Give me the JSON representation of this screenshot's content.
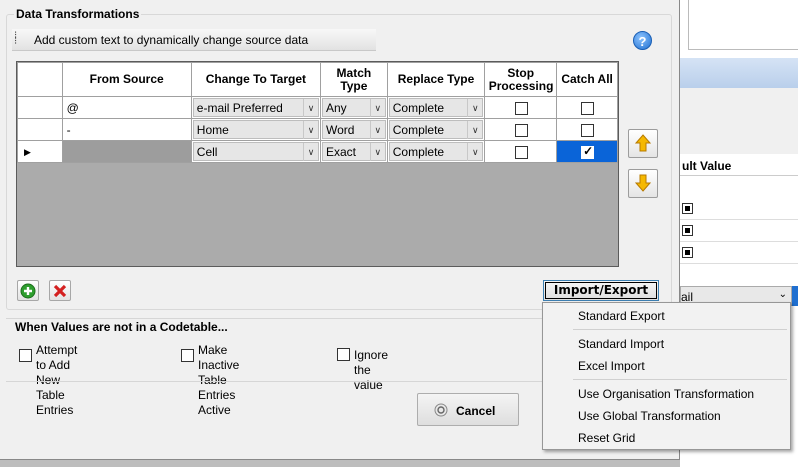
{
  "group_title": "Data Transformations",
  "info_bar_text": "Add custom text to dynamically change source data",
  "help_icon": "?",
  "grid": {
    "headers": [
      "",
      "From Source",
      "Change To Target",
      "Match Type",
      "Replace Type",
      "Stop Processing",
      "Catch All"
    ],
    "rows": [
      {
        "from": "@",
        "to": "e-mail Preferred",
        "match": "Any",
        "replace": "Complete",
        "stop": false,
        "catch_all": false
      },
      {
        "from": "-",
        "to": "Home",
        "match": "Word",
        "replace": "Complete",
        "stop": false,
        "catch_all": false
      },
      {
        "from": "",
        "to": "Cell",
        "match": "Exact",
        "replace": "Complete",
        "stop": false,
        "catch_all": true
      }
    ]
  },
  "import_export_label": "Import/Export",
  "codetable": {
    "title": "When Values are not in a Codetable...",
    "options": [
      {
        "line1": "Attempt to Add New",
        "line2": "Table Entries"
      },
      {
        "line1": "Make Inactive Table",
        "line2": "Entries Active"
      },
      {
        "line1": "Ignore the value",
        "line2": ""
      }
    ]
  },
  "cancel_label": "Cancel",
  "menu": {
    "items": [
      "Standard Export",
      "Standard Import",
      "Excel Import",
      "Use Organisation Transformation",
      "Use Global Transformation",
      "Reset Grid"
    ]
  },
  "background": {
    "column_header": "ult Value",
    "select_value": "ail"
  },
  "colors": {
    "selection_blue": "#0a64d8",
    "add_green": "#2e9e2e",
    "delete_red": "#d42020",
    "arrow_orange": "#f0a000"
  }
}
